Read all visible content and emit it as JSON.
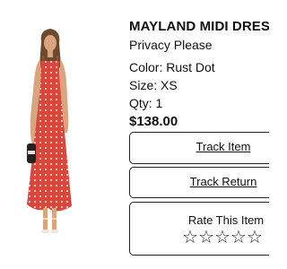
{
  "product": {
    "title": "MAYLAND MIDI DRESS",
    "brand": "Privacy Please",
    "color": "Color: Rust Dot",
    "size": "Size: XS",
    "qty": "Qty: 1",
    "price": "$138.00",
    "image_icon": "dress-photo"
  },
  "actions": {
    "track_item": "Track Item",
    "track_return": "Track Return"
  },
  "rating": {
    "label": "Rate This Item",
    "stars": [
      "☆",
      "☆",
      "☆",
      "☆",
      "☆"
    ],
    "star_icon": "star-outline-icon"
  },
  "colors": {
    "dress": "#d9463c",
    "dots": "#f7e6dc",
    "skin": "#d9a57e",
    "hair": "#6b4a2e",
    "border": "#222222"
  }
}
